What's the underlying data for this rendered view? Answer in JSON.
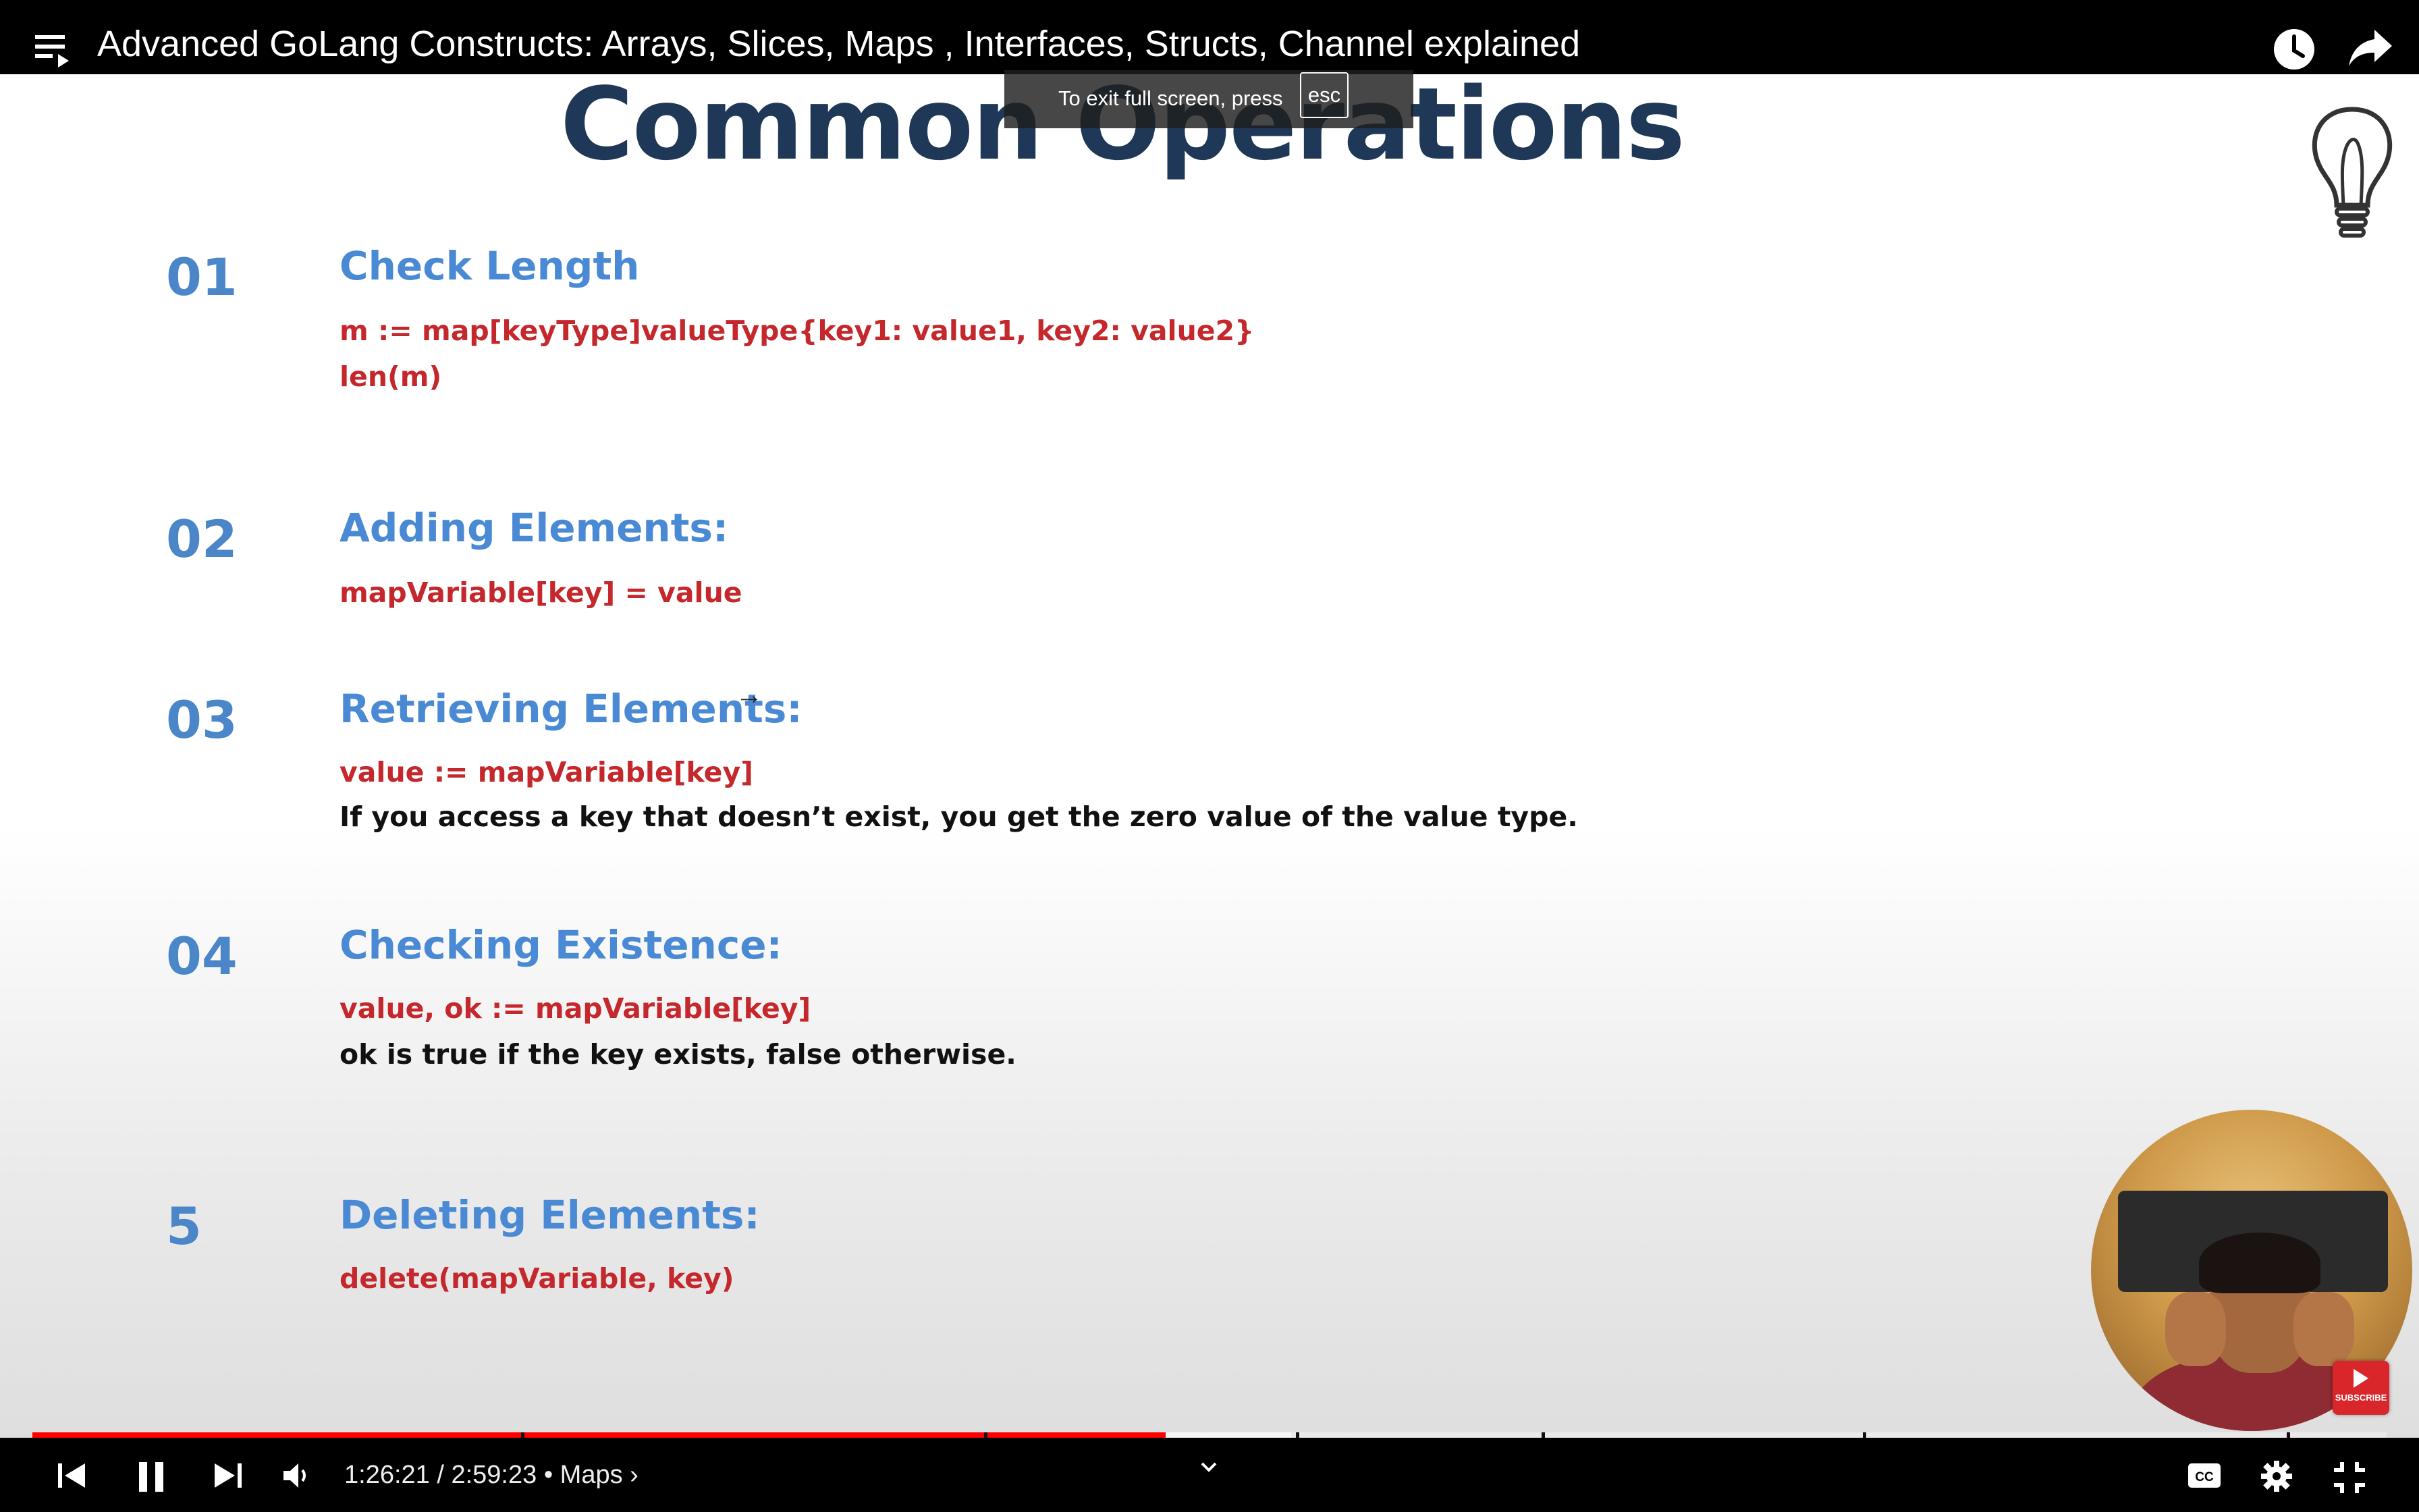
{
  "topbar": {
    "title": "Advanced GoLang Constructs: Arrays, Slices, Maps , Interfaces, Structs, Channel explained",
    "playlist_icon": "playlist-icon",
    "watch_later_icon": "clock-icon",
    "share_icon": "share-icon"
  },
  "toast": {
    "text": "To exit full screen, press",
    "key": "esc"
  },
  "slide": {
    "title": "Common Operations",
    "operations": [
      {
        "num": "01",
        "heading": "Check Length",
        "code": [
          "m := map[keyType]valueType{key1: value1, key2: value2}",
          "len(m)"
        ],
        "note": ""
      },
      {
        "num": "02",
        "heading": "Adding Elements:",
        "code": [
          "mapVariable[key] = value"
        ],
        "note": ""
      },
      {
        "num": "03",
        "heading": "Retrieving Elements:",
        "code": [
          "value := mapVariable[key]"
        ],
        "note": "If you access a key that doesn’t exist, you get the zero value of the value type."
      },
      {
        "num": "04",
        "heading": "Checking Existence:",
        "code": [
          "value, ok := mapVariable[key]"
        ],
        "note": "ok is true if the key exists, false otherwise."
      },
      {
        "num": "5",
        "heading": "Deleting Elements:",
        "code": [
          "delete(mapVariable, key)"
        ],
        "note": ""
      }
    ],
    "subscribe_badge": "SUBSCRIBE"
  },
  "player": {
    "current_time": "1:26:21",
    "duration": "2:59:23",
    "time_display": "1:26:21 / 2:59:23",
    "chapter": "• Maps",
    "played_fraction": 0.4814,
    "loaded_fraction": 0.5346,
    "colors": {
      "played": "#ff0000",
      "title_text": "#1f3857",
      "heading": "#4a8ad4",
      "code": "#c5282c"
    }
  }
}
